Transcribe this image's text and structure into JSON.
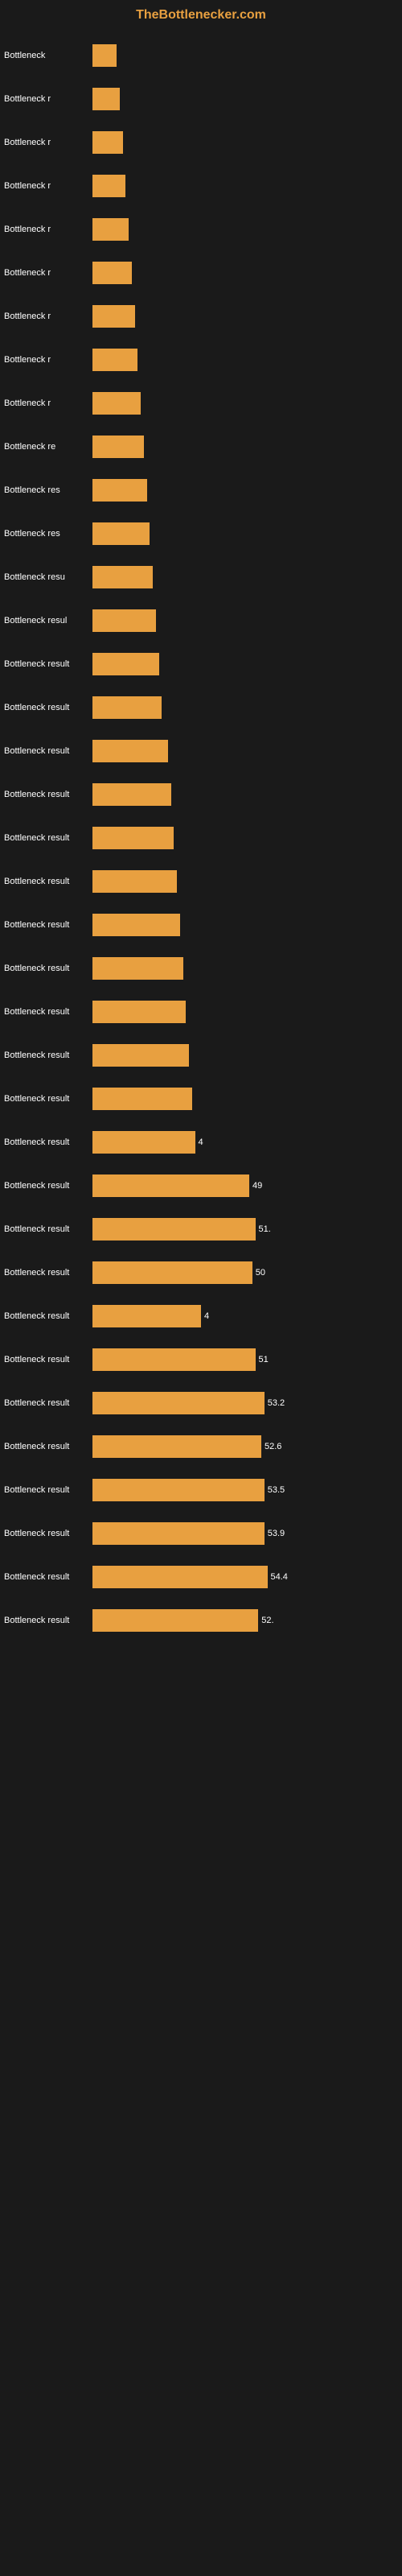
{
  "header": {
    "prefix": "The",
    "brand": "Bottlenecker",
    "suffix": ".com"
  },
  "chart": {
    "bars": [
      {
        "label": "Bottleneck",
        "value": null,
        "width_pct": 8
      },
      {
        "label": "Bottleneck r",
        "value": null,
        "width_pct": 9
      },
      {
        "label": "Bottleneck r",
        "value": null,
        "width_pct": 10
      },
      {
        "label": "Bottleneck r",
        "value": null,
        "width_pct": 11
      },
      {
        "label": "Bottleneck r",
        "value": null,
        "width_pct": 12
      },
      {
        "label": "Bottleneck r",
        "value": null,
        "width_pct": 13
      },
      {
        "label": "Bottleneck r",
        "value": null,
        "width_pct": 14
      },
      {
        "label": "Bottleneck r",
        "value": null,
        "width_pct": 15
      },
      {
        "label": "Bottleneck r",
        "value": null,
        "width_pct": 16
      },
      {
        "label": "Bottleneck re",
        "value": null,
        "width_pct": 17
      },
      {
        "label": "Bottleneck res",
        "value": null,
        "width_pct": 18
      },
      {
        "label": "Bottleneck res",
        "value": null,
        "width_pct": 19
      },
      {
        "label": "Bottleneck resu",
        "value": null,
        "width_pct": 20
      },
      {
        "label": "Bottleneck resul",
        "value": null,
        "width_pct": 21
      },
      {
        "label": "Bottleneck result",
        "value": null,
        "width_pct": 22
      },
      {
        "label": "Bottleneck result",
        "value": null,
        "width_pct": 23
      },
      {
        "label": "Bottleneck result",
        "value": null,
        "width_pct": 25
      },
      {
        "label": "Bottleneck result",
        "value": null,
        "width_pct": 26
      },
      {
        "label": "Bottleneck result",
        "value": null,
        "width_pct": 27
      },
      {
        "label": "Bottleneck result",
        "value": null,
        "width_pct": 28
      },
      {
        "label": "Bottleneck result",
        "value": null,
        "width_pct": 29
      },
      {
        "label": "Bottleneck result",
        "value": null,
        "width_pct": 30
      },
      {
        "label": "Bottleneck result",
        "value": null,
        "width_pct": 31
      },
      {
        "label": "Bottleneck result",
        "value": null,
        "width_pct": 32
      },
      {
        "label": "Bottleneck result",
        "value": null,
        "width_pct": 33
      },
      {
        "label": "Bottleneck result",
        "value": "4",
        "width_pct": 34
      },
      {
        "label": "Bottleneck result",
        "value": "49",
        "width_pct": 52
      },
      {
        "label": "Bottleneck result",
        "value": "51.",
        "width_pct": 54
      },
      {
        "label": "Bottleneck result",
        "value": "50",
        "width_pct": 53
      },
      {
        "label": "Bottleneck result",
        "value": "4",
        "width_pct": 36
      },
      {
        "label": "Bottleneck result",
        "value": "51",
        "width_pct": 54
      },
      {
        "label": "Bottleneck result",
        "value": "53.2",
        "width_pct": 57
      },
      {
        "label": "Bottleneck result",
        "value": "52.6",
        "width_pct": 56
      },
      {
        "label": "Bottleneck result",
        "value": "53.5",
        "width_pct": 57
      },
      {
        "label": "Bottleneck result",
        "value": "53.9",
        "width_pct": 57
      },
      {
        "label": "Bottleneck result",
        "value": "54.4",
        "width_pct": 58
      },
      {
        "label": "Bottleneck result",
        "value": "52.",
        "width_pct": 55
      }
    ]
  }
}
